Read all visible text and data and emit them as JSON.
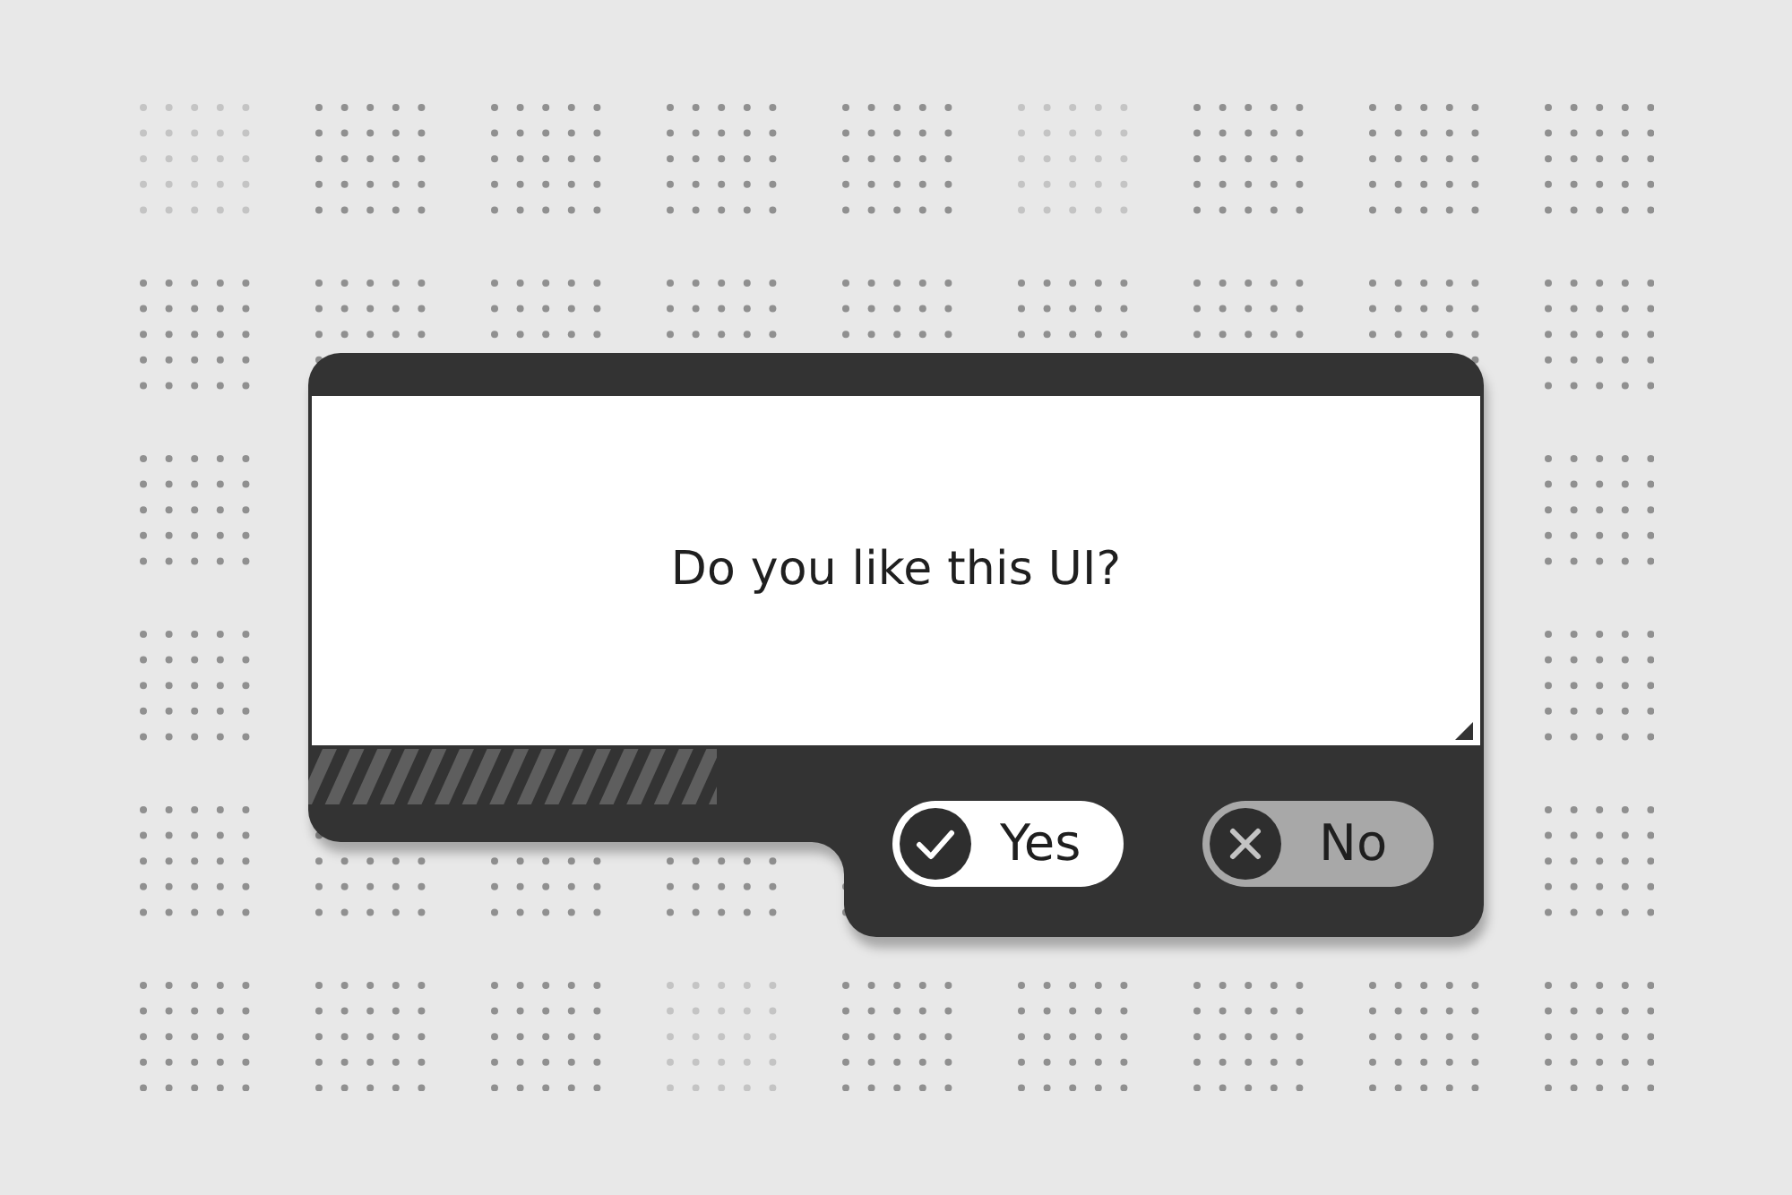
{
  "dialog": {
    "message": "Do you like this UI?",
    "buttons": [
      {
        "label": "Yes",
        "kind": "confirm"
      },
      {
        "label": "No",
        "kind": "cancel"
      }
    ]
  }
}
